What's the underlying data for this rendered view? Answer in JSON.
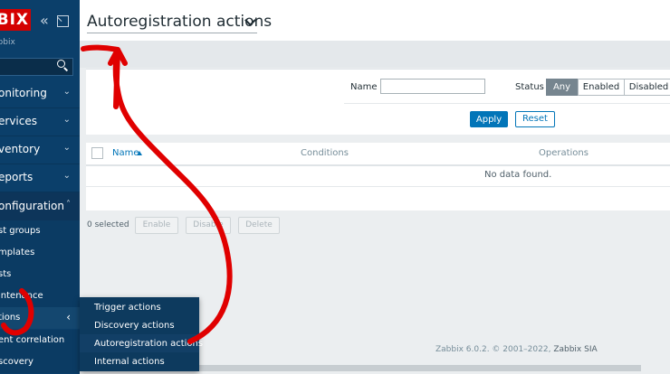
{
  "sidebar": {
    "logo": "BIX",
    "subtitle": "abbix",
    "search_placeholder": "",
    "menu": [
      {
        "label": "onitoring"
      },
      {
        "label": "ervices"
      },
      {
        "label": "ventory"
      },
      {
        "label": "eports"
      },
      {
        "label": "onfiguration"
      }
    ],
    "submenu": [
      {
        "label": "st groups"
      },
      {
        "label": "mplates"
      },
      {
        "label": "sts"
      },
      {
        "label": "intenance"
      },
      {
        "label": "tions"
      },
      {
        "label": "ent correlation"
      },
      {
        "label": "scovery"
      }
    ]
  },
  "flyout": {
    "items": [
      "Trigger actions",
      "Discovery actions",
      "Autoregistration actions",
      "Internal actions"
    ]
  },
  "header": {
    "title": "Autoregistration actions"
  },
  "filter": {
    "name_label": "Name",
    "name_value": "",
    "status_label": "Status",
    "status_options": [
      "Any",
      "Enabled",
      "Disabled"
    ],
    "status_selected": "Any",
    "apply_label": "Apply",
    "reset_label": "Reset"
  },
  "table": {
    "columns": [
      "Name",
      "Conditions",
      "Operations"
    ],
    "sort_column": "Name",
    "empty_text": "No data found."
  },
  "mass_actions": {
    "selected_text": "0 selected",
    "buttons": [
      "Enable",
      "Disable",
      "Delete"
    ]
  },
  "footer": {
    "text": "Zabbix 6.0.2. © 2001–2022, ",
    "link": "Zabbix SIA"
  },
  "colors": {
    "sidebar": "#0b3f6a",
    "logo": "#d40000",
    "primary": "#0275b8",
    "annotation": "#e00000"
  }
}
